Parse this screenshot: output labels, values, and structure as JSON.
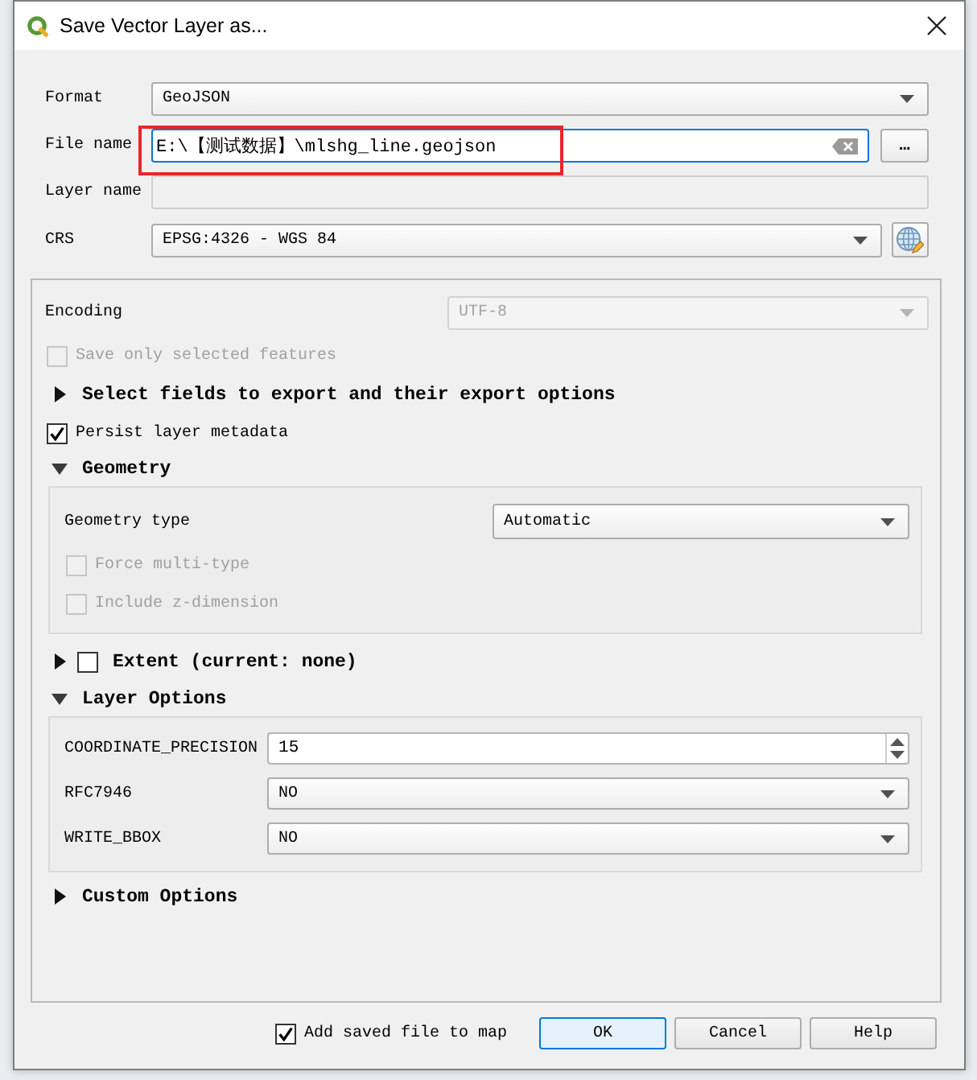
{
  "window": {
    "title": "Save Vector Layer as..."
  },
  "fields": [
    {
      "kind": "combo",
      "label": "Format",
      "value": "GeoJSON",
      "disabled": false
    },
    {
      "kind": "file",
      "label": "File name",
      "value": "E:\\【测试数据】\\mlshg_line.geojson",
      "disabled": false,
      "focused": true,
      "highlighted": true,
      "button": "…"
    },
    {
      "kind": "text",
      "label": "Layer name",
      "disabled": true
    },
    {
      "kind": "crs",
      "label": "CRS",
      "value": "EPSG:4326 - WGS 84",
      "disabled": false
    }
  ],
  "options": {
    "encoding": {
      "label": "Encoding",
      "value": "UTF-8",
      "disabled": true
    },
    "save_selected_only": {
      "label": "Save only selected features",
      "checked": false,
      "disabled": true
    },
    "select_fields": {
      "label": "Select fields to export and their export options",
      "expanded": false
    },
    "persist_metadata": {
      "label": "Persist layer metadata",
      "checked": true,
      "disabled": false
    },
    "geometry": {
      "label": "Geometry",
      "expanded": true,
      "geometry_type": {
        "label": "Geometry type",
        "value": "Automatic"
      },
      "checkboxes": [
        {
          "label": "Force multi-type",
          "checked": false,
          "disabled": true
        },
        {
          "label": "Include z-dimension",
          "checked": false,
          "disabled": true
        }
      ]
    },
    "extent": {
      "label": "Extent (current: none)",
      "expanded": false,
      "checked": false
    },
    "layer_options": {
      "label": "Layer Options",
      "expanded": true,
      "rows": [
        {
          "kind": "spin",
          "label": "COORDINATE_PRECISION",
          "value": "15"
        },
        {
          "kind": "combo",
          "label": "RFC7946",
          "value": "NO"
        },
        {
          "kind": "combo",
          "label": "WRITE_BBOX",
          "value": "NO"
        }
      ]
    },
    "custom_options": {
      "label": "Custom Options",
      "expanded": false
    }
  },
  "footer": {
    "add_to_map": {
      "label": "Add saved file to map",
      "checked": true
    },
    "buttons": [
      {
        "label": "OK",
        "default": true
      },
      {
        "label": "Cancel",
        "default": false
      },
      {
        "label": "Help",
        "default": false
      }
    ]
  }
}
